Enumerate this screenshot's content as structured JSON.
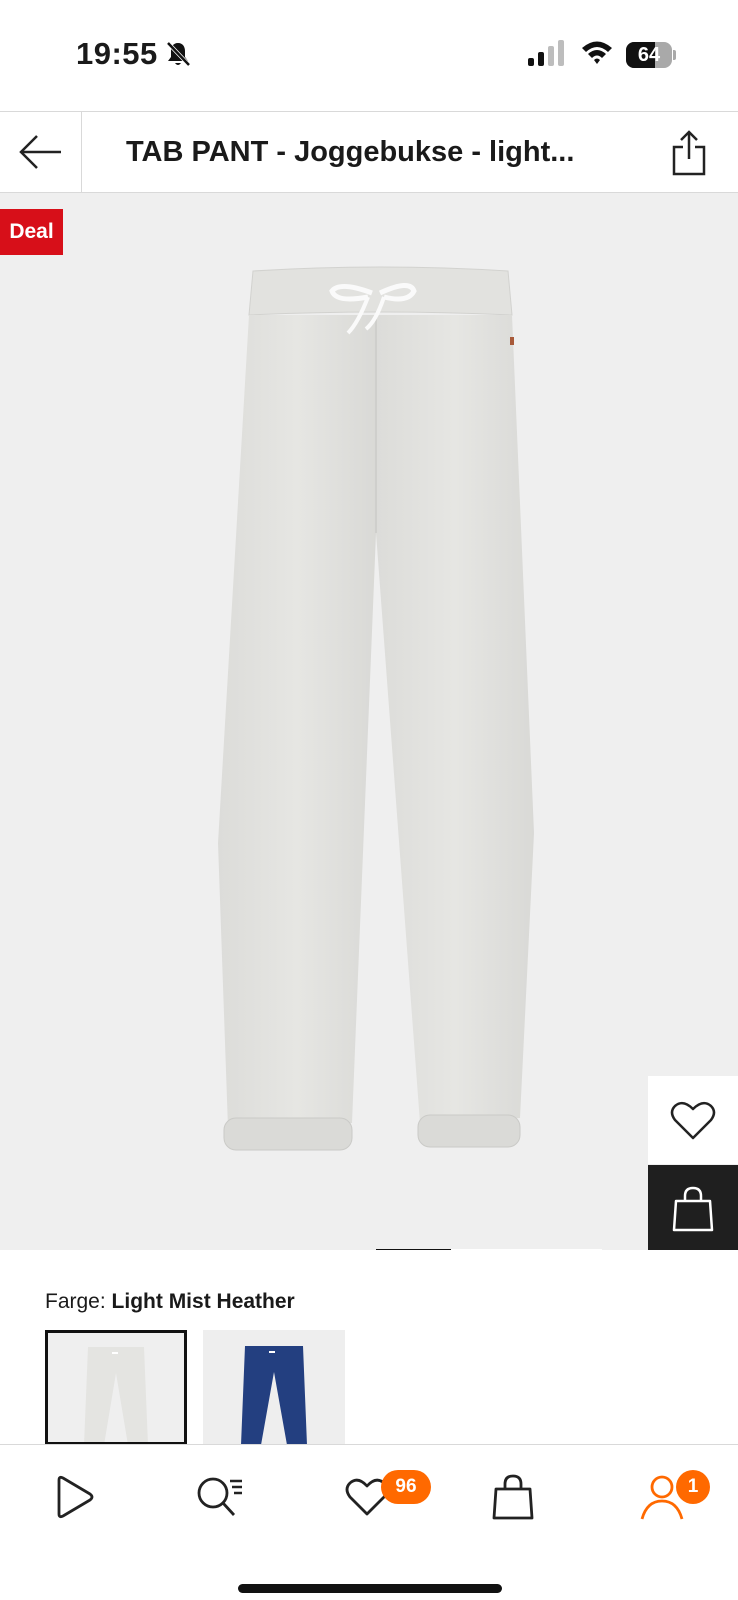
{
  "status_bar": {
    "time": "19:55",
    "battery": "64",
    "battery_level": 0.64
  },
  "header": {
    "title": "TAB PANT - Joggebukse - light..."
  },
  "product": {
    "deal_badge": "Deal",
    "gallery_position": 1,
    "gallery_count": 3
  },
  "color": {
    "label": "Farge:",
    "value": "Light Mist Heather",
    "swatches": [
      {
        "name": "light-grey",
        "color": "#e9e9e7",
        "selected": true
      },
      {
        "name": "navy",
        "color": "#1f3a7a",
        "selected": false
      }
    ]
  },
  "nav": {
    "wishlist_count": "96",
    "profile_count": "1"
  },
  "colors": {
    "accent": "#ff6900",
    "deal": "#d70f19",
    "image_bg": "#efefef"
  }
}
